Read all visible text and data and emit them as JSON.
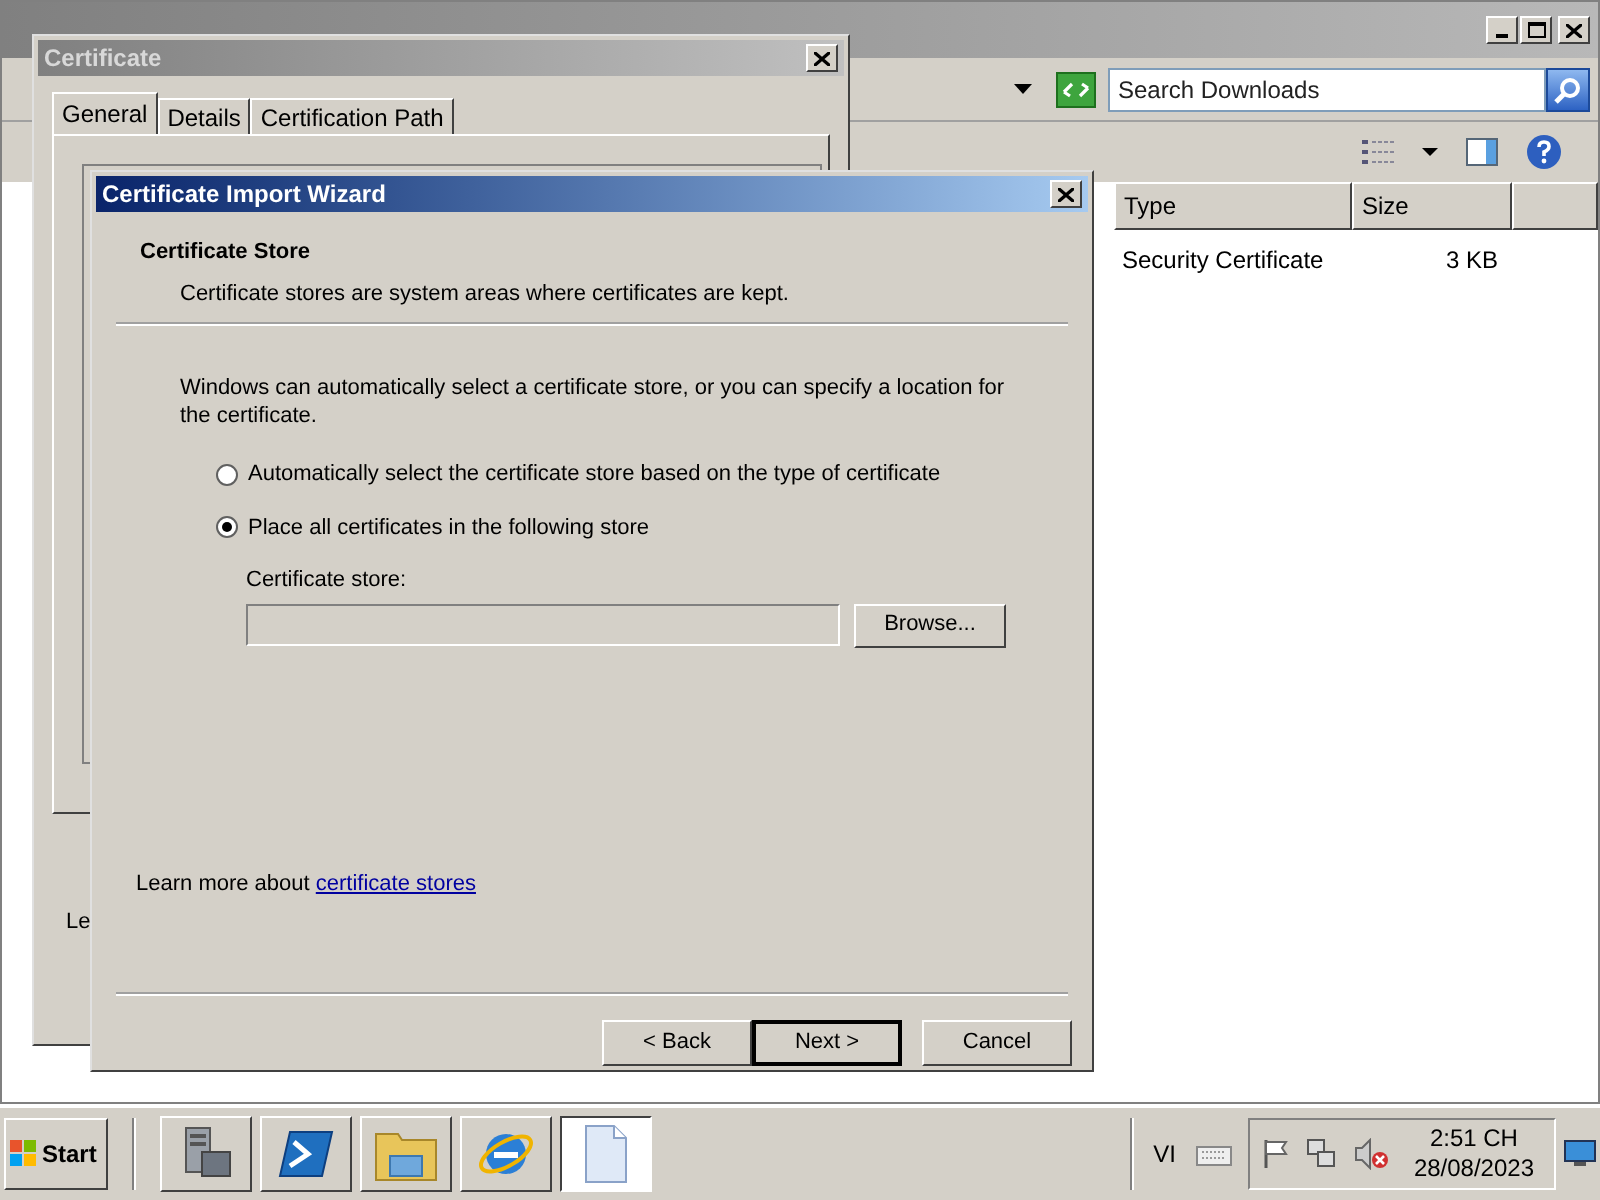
{
  "explorer": {
    "search": {
      "placeholder": "Search Downloads"
    },
    "columns": [
      "Type",
      "Size"
    ],
    "rows": [
      {
        "type": "Security Certificate",
        "size": "3 KB"
      }
    ]
  },
  "certificate_window": {
    "title": "Certificate",
    "tabs": [
      {
        "label": "General",
        "selected": true
      },
      {
        "label": "Details",
        "selected": false
      },
      {
        "label": "Certification Path",
        "selected": false
      }
    ],
    "partial_text": "Le"
  },
  "wizard": {
    "title": "Certificate Import Wizard",
    "heading": "Certificate Store",
    "subheading": "Certificate stores are system areas where certificates are kept.",
    "description": "Windows can automatically select a certificate store, or you can specify a location for the certificate.",
    "options": [
      {
        "label": "Automatically select the certificate store based on the type of certificate",
        "selected": false
      },
      {
        "label": "Place all certificates in the following store",
        "selected": true
      }
    ],
    "store_label": "Certificate store:",
    "browse": "Browse...",
    "learn_more": "Learn more about ",
    "link": "certificate stores",
    "buttons": [
      {
        "label": "< Back",
        "default": false
      },
      {
        "label": "Next >",
        "default": true
      },
      {
        "label": "Cancel",
        "default": false
      }
    ]
  },
  "taskbar": {
    "start": "Start",
    "apps": [
      {
        "kind": "server",
        "selected": false
      },
      {
        "kind": "shell",
        "selected": false
      },
      {
        "kind": "folder",
        "selected": false
      },
      {
        "kind": "browser",
        "selected": false
      },
      {
        "kind": "document",
        "selected": true
      }
    ],
    "language": "VI",
    "time": "2:51 CH",
    "date": "28/08/2023"
  }
}
